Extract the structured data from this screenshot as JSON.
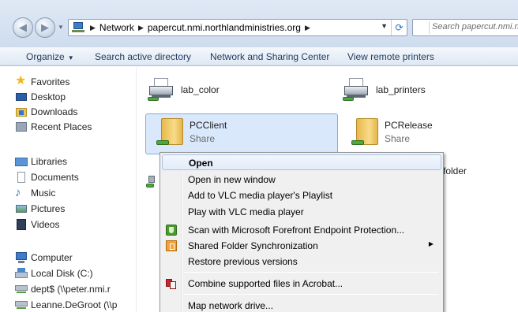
{
  "address_bar": {
    "breadcrumbs": [
      "Network",
      "papercut.nmi.northlandministries.org"
    ],
    "search_placeholder": "Search papercut.nmi.northlandministries.org"
  },
  "toolbar": {
    "organize": "Organize",
    "search_ad": "Search active directory",
    "network_center": "Network and Sharing Center",
    "view_printers": "View remote printers"
  },
  "nav_pane": {
    "favorites": {
      "label": "Favorites",
      "items": [
        "Desktop",
        "Downloads",
        "Recent Places"
      ]
    },
    "libraries": {
      "label": "Libraries",
      "items": [
        "Documents",
        "Music",
        "Pictures",
        "Videos"
      ]
    },
    "computer": {
      "label": "Computer",
      "items": [
        "Local Disk (C:)",
        "dept$ (\\\\peter.nmi.r",
        "Leanne.DeGroot (\\\\p"
      ]
    }
  },
  "content": {
    "items": [
      {
        "name": "lab_color",
        "type": "printer"
      },
      {
        "name": "lab_printers",
        "type": "printer"
      },
      {
        "name": "PCClient",
        "subtitle": "Share",
        "type": "share"
      },
      {
        "name": "PCRelease",
        "subtitle": "Share",
        "type": "share"
      }
    ],
    "obscured_label": "-folder"
  },
  "context_menu": {
    "items": [
      {
        "label": "Open",
        "bold": true
      },
      {
        "label": "Open in new window"
      },
      {
        "label": "Add to VLC media player's Playlist"
      },
      {
        "label": "Play with VLC media player"
      },
      {
        "label": "Scan with Microsoft Forefront Endpoint Protection...",
        "icon": "forefront-icon"
      },
      {
        "label": "Shared Folder Synchronization",
        "icon": "sync-icon",
        "submenu": true
      },
      {
        "label": "Restore previous versions"
      },
      {
        "label": "Combine supported files in Acrobat...",
        "icon": "acrobat-icon"
      },
      {
        "label": "Map network drive..."
      }
    ]
  },
  "colors": {
    "accent": "#3399ff",
    "selection": "#d9e8fb",
    "menu_bg": "#f0f0f0"
  }
}
